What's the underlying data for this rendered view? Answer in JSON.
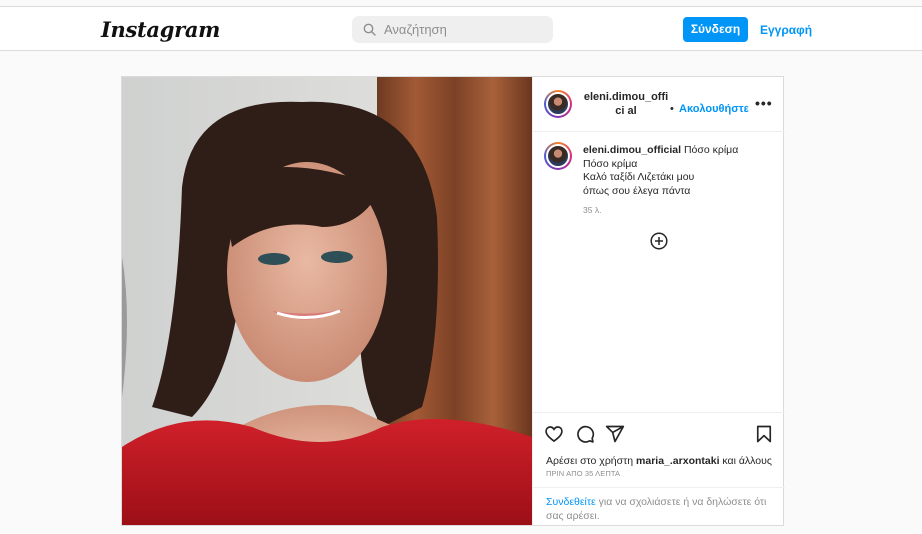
{
  "header": {
    "logo": "Instagram",
    "search_placeholder": "Αναζήτηση",
    "login_label": "Σύνδεση",
    "signup_label": "Εγγραφή"
  },
  "post": {
    "username": "eleni.dimou_official",
    "username_wrapped": "eleni.dimou_offici al",
    "separator": "•",
    "follow_label": "Ακολουθήστε",
    "more_label": "•••",
    "caption_username": "eleni.dimou_official",
    "caption_lines": [
      "Πόσο κρίμα",
      "Πόσο κρίμα",
      "Καλό ταξίδι Λιζετάκι μου",
      "όπως σου έλεγα πάντα"
    ],
    "caption_time": "35 λ.",
    "likes_prefix": "Αρέσει στο χρήστη",
    "likes_user": "maria_.arxontaki",
    "likes_suffix": "και άλλους",
    "post_time": "ΠΡΙΝ ΑΠΟ 35 ΛΕΠΤΑ",
    "login_link": "Συνδεθείτε",
    "login_text": "για να σχολιάσετε ή να δηλώσετε ότι σας αρέσει."
  },
  "icons": [
    "search-icon",
    "more-options-icon",
    "add-comment-icon",
    "heart-icon",
    "comment-icon",
    "share-icon",
    "bookmark-icon"
  ],
  "colors": {
    "accent": "#0095f6",
    "border": "#dbdbdb",
    "background": "#fafafa",
    "muted": "#8e8e8e"
  }
}
